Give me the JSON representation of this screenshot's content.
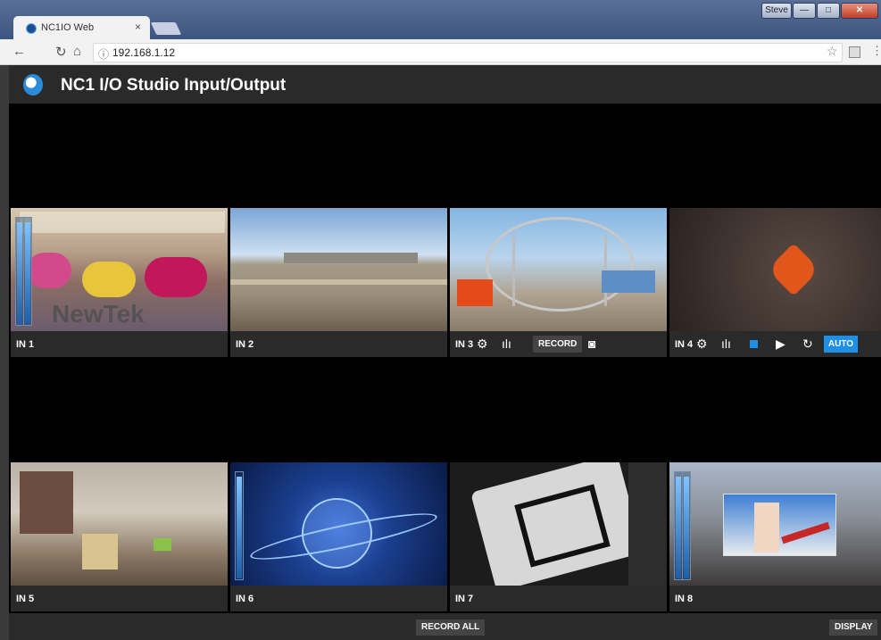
{
  "browser": {
    "tab_title": "NC1IO Web",
    "tab_close": "×",
    "url": "192.168.1.12",
    "user_button": "Steve",
    "minimize": "—",
    "maximize": "□",
    "close": "✕"
  },
  "app": {
    "title": "NC1 I/O Studio Input/Output"
  },
  "inputs": [
    {
      "name": "IN 1",
      "vu_level": 0.95
    },
    {
      "name": "IN 2"
    },
    {
      "name": "IN 3",
      "record_label": "RECORD"
    },
    {
      "name": "IN 4",
      "auto_label": "AUTO"
    },
    {
      "name": "IN 5"
    },
    {
      "name": "IN 6",
      "vu_level": 0.95
    },
    {
      "name": "IN 7"
    },
    {
      "name": "IN 8",
      "vu_level": 0.95
    }
  ],
  "footer": {
    "record_all": "RECORD ALL",
    "display": "DISPLAY"
  },
  "colors": {
    "accent": "#1e8fe6",
    "panel": "#2a2a2a"
  }
}
